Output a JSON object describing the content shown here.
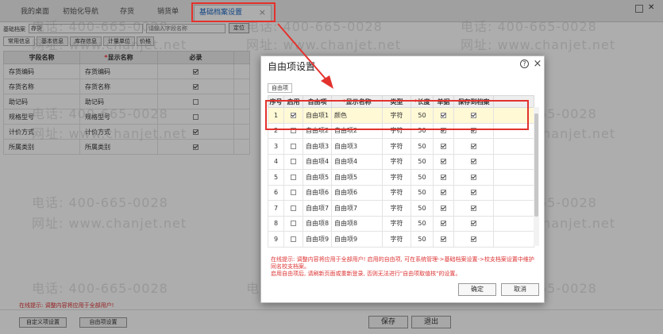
{
  "tabs": [
    {
      "label": "我的桌面"
    },
    {
      "label": "初始化导航"
    },
    {
      "label": "存货"
    },
    {
      "label": "销货单"
    },
    {
      "label": "基础档案设置",
      "active": true
    }
  ],
  "tab_close": "×",
  "page": {
    "archive_label": "基础档案",
    "archive_value": "存货",
    "search_placeholder": "请输入字段名称",
    "locate_button": "定位",
    "subtabs": [
      "常用信息",
      "基本信息",
      "库存信息",
      "计量单位",
      "价格"
    ],
    "columns": [
      "字段名称",
      "显示名称",
      "必录"
    ],
    "required_mark": "*",
    "rows": [
      {
        "name": "存货编码",
        "display": "存货编码",
        "required": true
      },
      {
        "name": "存货名称",
        "display": "存货名称",
        "required": true
      },
      {
        "name": "助记码",
        "display": "助记码",
        "required": false
      },
      {
        "name": "规格型号",
        "display": "规格型号",
        "required": false
      },
      {
        "name": "计价方式",
        "display": "计价方式",
        "required": true
      },
      {
        "name": "所属类别",
        "display": "所属类别",
        "required": true
      }
    ],
    "tip": "在线提示: 调整内容将应用于全部用户!",
    "custom_button": "自定义项设置",
    "free_button": "自由项设置",
    "save_button": "保存",
    "exit_button": "退出"
  },
  "dialog": {
    "title": "自由项设置",
    "help_icon": "?",
    "close_icon": "×",
    "tab_label": "自由项",
    "columns": [
      "序号",
      "启用",
      "自由项",
      "显示名称",
      "类型",
      "长度",
      "单据",
      "保存到档案"
    ],
    "required_mark": "*",
    "rows": [
      {
        "no": "1",
        "enabled": true,
        "item": "自由项1",
        "display": "颜色",
        "type": "字符",
        "length": "50",
        "doc": true,
        "save": true
      },
      {
        "no": "2",
        "enabled": false,
        "item": "自由项2",
        "display": "自由项2",
        "type": "字符",
        "length": "50",
        "doc": true,
        "save": true
      },
      {
        "no": "3",
        "enabled": false,
        "item": "自由项3",
        "display": "自由项3",
        "type": "字符",
        "length": "50",
        "doc": true,
        "save": true
      },
      {
        "no": "4",
        "enabled": false,
        "item": "自由项4",
        "display": "自由项4",
        "type": "字符",
        "length": "50",
        "doc": true,
        "save": true
      },
      {
        "no": "5",
        "enabled": false,
        "item": "自由项5",
        "display": "自由项5",
        "type": "字符",
        "length": "50",
        "doc": true,
        "save": true
      },
      {
        "no": "6",
        "enabled": false,
        "item": "自由项6",
        "display": "自由项6",
        "type": "字符",
        "length": "50",
        "doc": true,
        "save": true
      },
      {
        "no": "7",
        "enabled": false,
        "item": "自由项7",
        "display": "自由项7",
        "type": "字符",
        "length": "50",
        "doc": true,
        "save": true
      },
      {
        "no": "8",
        "enabled": false,
        "item": "自由项8",
        "display": "自由项8",
        "type": "字符",
        "length": "50",
        "doc": true,
        "save": true
      },
      {
        "no": "9",
        "enabled": false,
        "item": "自由项9",
        "display": "自由项9",
        "type": "字符",
        "length": "50",
        "doc": true,
        "save": true
      }
    ],
    "tip_lines": [
      "在线提示: 调整内容将应用于全部用户! 启用的自由项, 可在系统管理->基础档案设置->校支档案设置中维护同名校支档案。",
      "启用自由项后, 请刷新页面或重新登录, 否则无法进行\"自由项取值核\"的设置。"
    ],
    "ok_button": "确定",
    "cancel_button": "取消"
  },
  "watermarks": {
    "phone": "电话: 400-665-0028",
    "site": "网址: www.chanjet.net"
  },
  "colors": {
    "active_tab": "#1a66c2",
    "annotation": "#e3322d",
    "tip": "#dd3333",
    "highlight_row": "#fff9d6"
  }
}
